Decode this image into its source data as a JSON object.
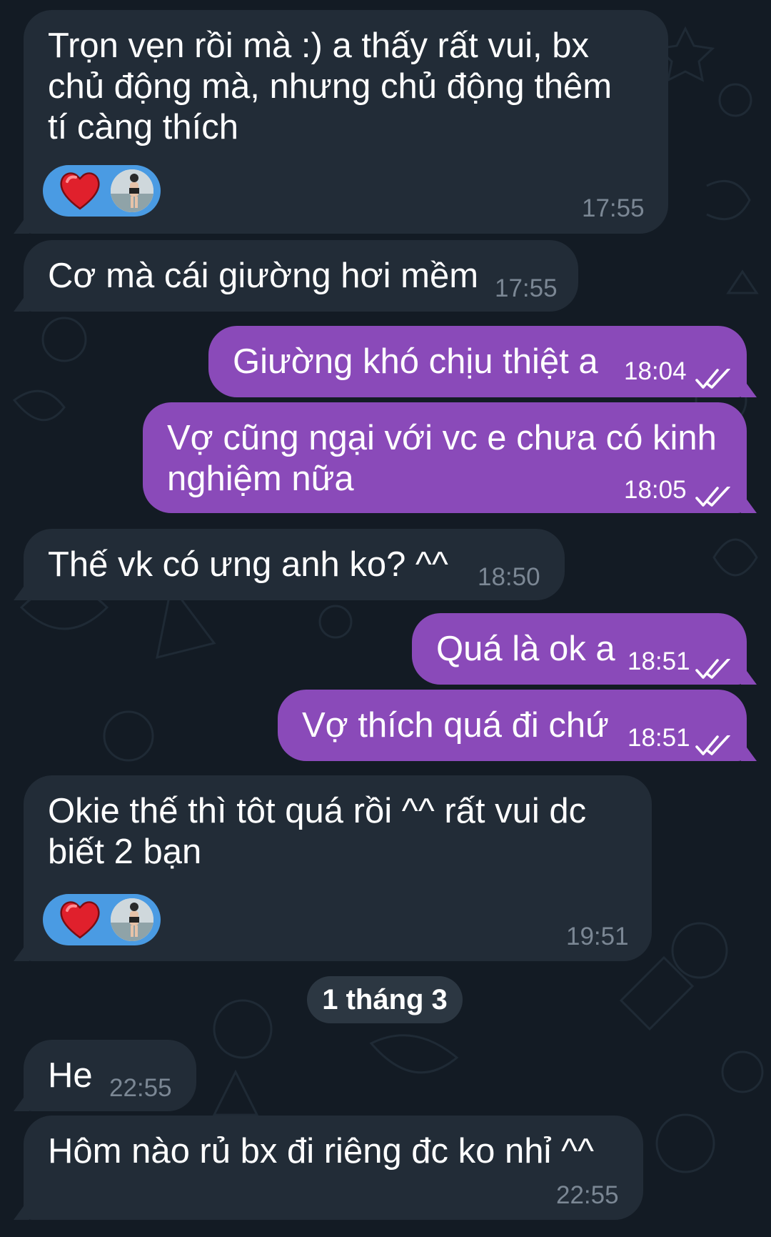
{
  "chat": {
    "date_separator": "1 tháng 3",
    "messages": [
      {
        "direction": "incoming",
        "lines": [
          "Trọn vẹn rồi mà :) a thấy rất vui, bx",
          "chủ động mà, nhưng chủ động thêm",
          "tí càng thích"
        ],
        "time": "17:55",
        "reactions": [
          "heart-emoji",
          "user-avatar"
        ]
      },
      {
        "direction": "incoming",
        "lines": [
          "Cơ mà cái giường hơi mềm"
        ],
        "time": "17:55"
      },
      {
        "direction": "outgoing",
        "lines": [
          "Giường khó chịu thiệt a"
        ],
        "time": "18:04",
        "status": "read"
      },
      {
        "direction": "outgoing",
        "lines": [
          "Vợ cũng ngại với vc e chưa có kinh",
          "nghiệm nữa"
        ],
        "time": "18:05",
        "status": "read"
      },
      {
        "direction": "incoming",
        "lines": [
          "Thế vk có ưng anh ko? ^^"
        ],
        "time": "18:50"
      },
      {
        "direction": "outgoing",
        "lines": [
          "Quá là ok a"
        ],
        "time": "18:51",
        "status": "read"
      },
      {
        "direction": "outgoing",
        "lines": [
          "Vợ thích quá đi chứ"
        ],
        "time": "18:51",
        "status": "read"
      },
      {
        "direction": "incoming",
        "lines": [
          "Okie thế thì tôt quá rồi ^^ rất vui dc",
          "biết 2 bạn"
        ],
        "time": "19:51",
        "reactions": [
          "heart-emoji",
          "user-avatar"
        ]
      },
      {
        "direction": "incoming",
        "lines": [
          "He"
        ],
        "time": "22:55"
      },
      {
        "direction": "incoming",
        "lines": [
          "Hôm nào rủ bx đi riêng đc ko nhỉ ^^"
        ],
        "time": "22:55"
      }
    ]
  },
  "colors": {
    "background": "#131b24",
    "incoming_bubble": "#222c37",
    "outgoing_bubble": "#8a4ab9",
    "reaction_chip": "#4a9be3",
    "date_chip": "#2c3742"
  }
}
